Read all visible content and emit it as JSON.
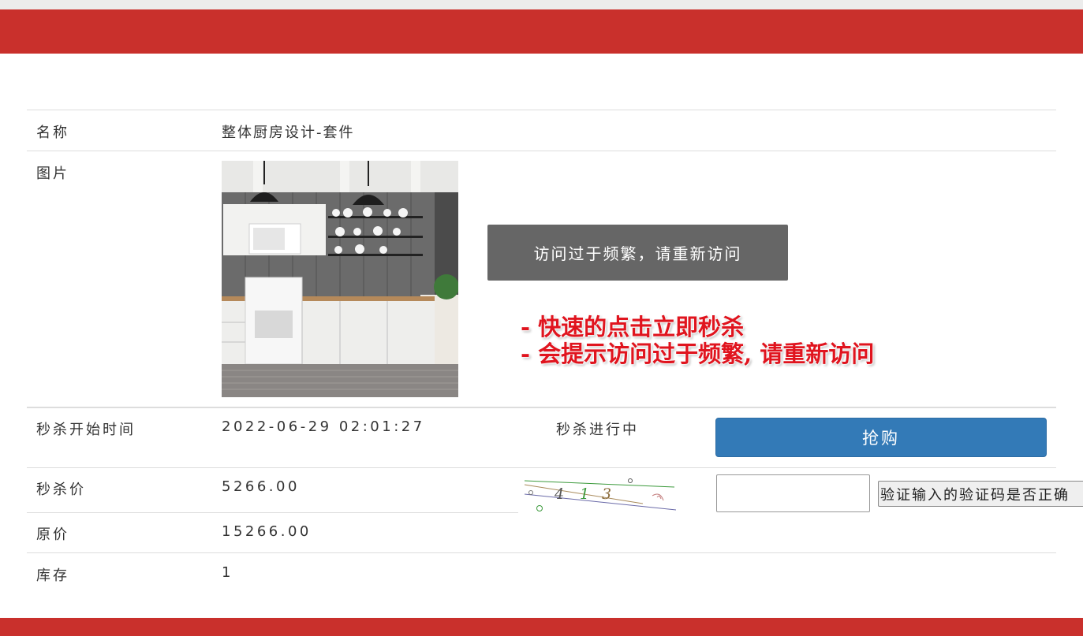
{
  "product": {
    "name_label": "名称",
    "name_value": "整体厨房设计-套件",
    "image_label": "图片",
    "start_time_label": "秒杀开始时间",
    "start_time_value": "2022-06-29 02:01:27",
    "status_text": "秒杀进行中",
    "seckill_price_label": "秒杀价",
    "seckill_price_value": "5266.00",
    "original_price_label": "原价",
    "original_price_value": "15266.00",
    "stock_label": "库存",
    "stock_value": "1"
  },
  "actions": {
    "buy_label": "抢购",
    "verify_label": "验证输入的验证码是否正确",
    "captcha_input_value": ""
  },
  "captcha": {
    "digits": [
      "4",
      "1",
      "3"
    ]
  },
  "toast": {
    "message": "访问过于频繁，请重新访问"
  },
  "annotation": {
    "line1": "- 快速的点击立即秒杀",
    "line2": "- 会提示访问过于频繁, 请重新访问"
  },
  "colors": {
    "header": "#c9302c",
    "button": "#337ab7",
    "toast_bg": "#666666",
    "annotation": "#e0141e"
  }
}
